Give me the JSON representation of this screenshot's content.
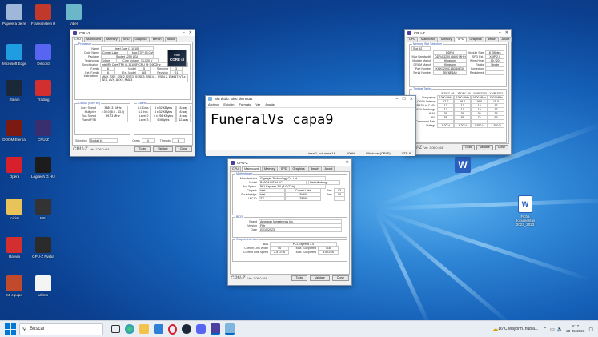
{
  "desktop": {
    "icons_left": [
      {
        "label": "Papelera de reciclaje",
        "icon": "recycle-bin-icon",
        "color": "#9fb7d8"
      },
      {
        "label": "Microsoft Edge",
        "icon": "edge-icon",
        "color": "#1f9de0"
      },
      {
        "label": "Steam",
        "icon": "steam-icon",
        "color": "#1b2838"
      },
      {
        "label": "DOOM Eternal",
        "icon": "doom-icon",
        "color": "#7a1a12"
      },
      {
        "label": "Opera",
        "icon": "opera-icon",
        "color": "#d81f2c"
      },
      {
        "label": "Iniciar",
        "icon": "folder-icon",
        "color": "#e8c35a"
      },
      {
        "label": "Rayvm",
        "icon": "pdf-icon",
        "color": "#d42f2f"
      },
      {
        "label": "Mi equipo",
        "icon": "pc-icon",
        "color": "#c24a2c"
      }
    ],
    "icons_col2": [
      {
        "label": "Frankenstein Rahnaweise",
        "icon": "app-icon",
        "color": "#c0392b"
      },
      {
        "label": "Discord",
        "icon": "discord-icon",
        "color": "#5865f2"
      },
      {
        "label": "Trading",
        "icon": "pdf-icon",
        "color": "#d42f2f"
      },
      {
        "label": "CPU-Z",
        "icon": "cpuz-icon",
        "color": "#3a2f6e"
      },
      {
        "label": "Logitech G HUB",
        "icon": "ghub-icon",
        "color": "#1c1c1c"
      },
      {
        "label": "MSI",
        "icon": "app-icon",
        "color": "#333333"
      },
      {
        "label": "GPU-Z Nvidia",
        "icon": "gpuz-icon",
        "color": "#2b2b2b"
      },
      {
        "label": "ultimo",
        "icon": "file-icon",
        "color": "#f4f4f4"
      }
    ],
    "icons_col3": [
      {
        "label": "Viber",
        "icon": "app-icon",
        "color": "#6bb6c9"
      }
    ],
    "icons_right": [
      {
        "label": "",
        "icon": "word-icon",
        "color": "#2b5fbe"
      },
      {
        "label": "Ficha documentos 2023_2023",
        "icon": "word-doc-icon",
        "color": "#2b5fbe"
      }
    ]
  },
  "cpuz_cpu": {
    "title": "CPU-Z",
    "tabs": [
      "CPU",
      "Mainboard",
      "Memory",
      "SPD",
      "Graphics",
      "Bench",
      "About"
    ],
    "processor_label": "Processor",
    "fields": [
      {
        "k": "Name",
        "v": "Intel Core i3 10100"
      },
      {
        "k": "Code Name",
        "v": "Comet Lake"
      },
      {
        "k": "Package",
        "v": "Socket 1200 LGA"
      },
      {
        "k": "Technology",
        "v": "14 nm"
      },
      {
        "k": "Specification",
        "v": "Intel(R) Core(TM) i3-10100F CPU @ 3.60GHz"
      },
      {
        "k": "Family",
        "v": "6"
      },
      {
        "k": "Ext. Family",
        "v": "6"
      },
      {
        "k": "Instructions",
        "v": "MMX, SSE, SSE2, SSE3, SSSE3, SSE4.1, SSE4.2, EM64T, VT-x, AES, AVX, AVX2, FMA3"
      }
    ],
    "max_tdp": "Max TDP  65.0 W",
    "core_voltage": "1.020 V",
    "clocks_label": "Clocks (Core #0)",
    "clocks": [
      {
        "k": "Core Speed",
        "v": "3889.31 MHz"
      },
      {
        "k": "Multiplier",
        "v": "x 39.0 (8.0 - 43.0)"
      },
      {
        "k": "Bus Speed",
        "v": "99.73 MHz"
      },
      {
        "k": "Rated FSB",
        "v": ""
      }
    ],
    "cache_label": "Cache",
    "cache": [
      {
        "k": "L1 Data",
        "v": "4 x 32 KBytes",
        "w": "8-way"
      },
      {
        "k": "L1 Inst.",
        "v": "4 x 32 KBytes",
        "w": "8-way"
      },
      {
        "k": "Level 2",
        "v": "4 x 256 KBytes",
        "w": "4-way"
      },
      {
        "k": "Level 3",
        "v": "6 MBytes",
        "w": "12-way"
      }
    ],
    "selection_label": "Selection",
    "selection_value": "Socket #1",
    "cores_label": "Cores",
    "cores": "4",
    "threads_label": "Threads",
    "threads": "8",
    "version": "Ver. 2.06.0.x64",
    "tools": "Tools",
    "validate": "Validate",
    "close": "Close",
    "badge_line1": "intel",
    "badge_line2": "CORE i3"
  },
  "cpuz_spd": {
    "title": "CPU-Z",
    "tabs": [
      "CPU",
      "Mainboard",
      "Memory",
      "SPD",
      "Graphics",
      "Bench",
      "About"
    ],
    "slot_label": "Memory Slot Selection",
    "slot": "Slot #2",
    "fields": [
      {
        "k": "",
        "v": "DDR4",
        "k2": "Module Size",
        "v2": "8 GBytes"
      },
      {
        "k": "Max Bandwidth",
        "v": "DDR4-3200 (1600 MHz)",
        "k2": "SPD Ext.",
        "v2": "XMP 2.0"
      },
      {
        "k": "Module Manuf.",
        "v": "Kingston",
        "k2": "Week/Year",
        "v2": "19 / 20"
      },
      {
        "k": "DRAM Manuf.",
        "v": "Kingston",
        "k2": "Ranks",
        "v2": "Single"
      },
      {
        "k": "Part Number",
        "v": "KHX3200C16D4/8GX",
        "k2": "Correction",
        "v2": ""
      },
      {
        "k": "Serial Number",
        "v": "2BF6E6A5",
        "k2": "Registered",
        "v2": ""
      }
    ],
    "timings_label": "Timings Table",
    "timing_cols": [
      "JEDEC #8",
      "JEDEC #9",
      "XMP-3200",
      "XMP-3002"
    ],
    "timing_rows": [
      {
        "k": "Frequency",
        "v": [
          "1200 MHz",
          "1200 MHz",
          "1600 MHz",
          "1501 MHz"
        ]
      },
      {
        "k": "CAS# Latency",
        "v": [
          "17.0",
          "18.0",
          "16.0",
          "15.0"
        ]
      },
      {
        "k": "RAS# to CAS#",
        "v": [
          "17",
          "17",
          "18",
          "17"
        ]
      },
      {
        "k": "RAS# Precharge",
        "v": [
          "17",
          "17",
          "18",
          "17"
        ]
      },
      {
        "k": "tRAS",
        "v": [
          "39",
          "39",
          "36",
          "35"
        ]
      },
      {
        "k": "tRC",
        "v": [
          "55",
          "55",
          "74",
          "69"
        ]
      },
      {
        "k": "Command Rate",
        "v": [
          "",
          "",
          "",
          ""
        ]
      },
      {
        "k": "Voltage",
        "v": [
          "1.20 V",
          "1.20 V",
          "1.350 V",
          "1.350 V"
        ]
      }
    ],
    "version": "Ver. 2.06.0.x64",
    "tools": "Tools",
    "validate": "Validate",
    "close": "Close"
  },
  "cpuz_mb": {
    "title": "CPU-Z",
    "tabs": [
      "CPU",
      "Mainboard",
      "Memory",
      "SPD",
      "Graphics",
      "Bench",
      "About"
    ],
    "mb_label": "Motherboard",
    "fields": [
      {
        "k": "Manufacturer",
        "v": "Gigabyte Technology Co. Ltd.",
        "x": ""
      },
      {
        "k": "Model",
        "v": "B460M DS3H AC",
        "x": "Default string"
      },
      {
        "k": "Bus Specs.",
        "v": "PCI-Express 3.0 (8.0 GT/s)",
        "x": ""
      }
    ],
    "chip_rows": [
      {
        "k": "Chipset",
        "a": "Intel",
        "b": "Comet Lake",
        "r": "Rev.",
        "rv": "03"
      },
      {
        "k": "Southbridge",
        "a": "Intel",
        "b": "B460",
        "r": "Rev.",
        "rv": "00"
      },
      {
        "k": "LPCIO",
        "a": "ITE",
        "b": "IT8688",
        "r": "",
        "rv": ""
      }
    ],
    "bios_label": "BIOS",
    "bios": [
      {
        "k": "Brand",
        "v": "American Megatrends Inc."
      },
      {
        "k": "Version",
        "v": "F6b"
      },
      {
        "k": "Date",
        "v": "03/15/2023"
      }
    ],
    "gi_label": "Graphic Interface",
    "gi_bus_k": "Bus",
    "gi_bus_v": "PCI-Express 3.0",
    "gi_rows": [
      {
        "k": "Current Link Width",
        "v": "x4",
        "k2": "Max. Supported",
        "v2": "x16"
      },
      {
        "k": "Current Link Speed",
        "v": "2.5 GT/s",
        "k2": "Max. Supported",
        "v2": "8.0 GT/s"
      }
    ],
    "version": "Ver. 2.06.0.x64",
    "tools": "Tools",
    "validate": "Validate",
    "close": "Close"
  },
  "notepad": {
    "title": "Sin título: Bloc de notas",
    "menu": [
      "Archivo",
      "Edición",
      "Formato",
      "Ver",
      "Ayuda"
    ],
    "content": "FuneralVs capa9",
    "status": [
      "Línea 1, columna 16",
      "100%",
      "Windows (CRLF)",
      "UTF-8"
    ]
  },
  "taskbar": {
    "search_placeholder": "Buscar",
    "weather": "16°C  Mayorm. nubla...",
    "time": "8:17",
    "date": "28-05-2023",
    "accent": "#0067c0"
  }
}
